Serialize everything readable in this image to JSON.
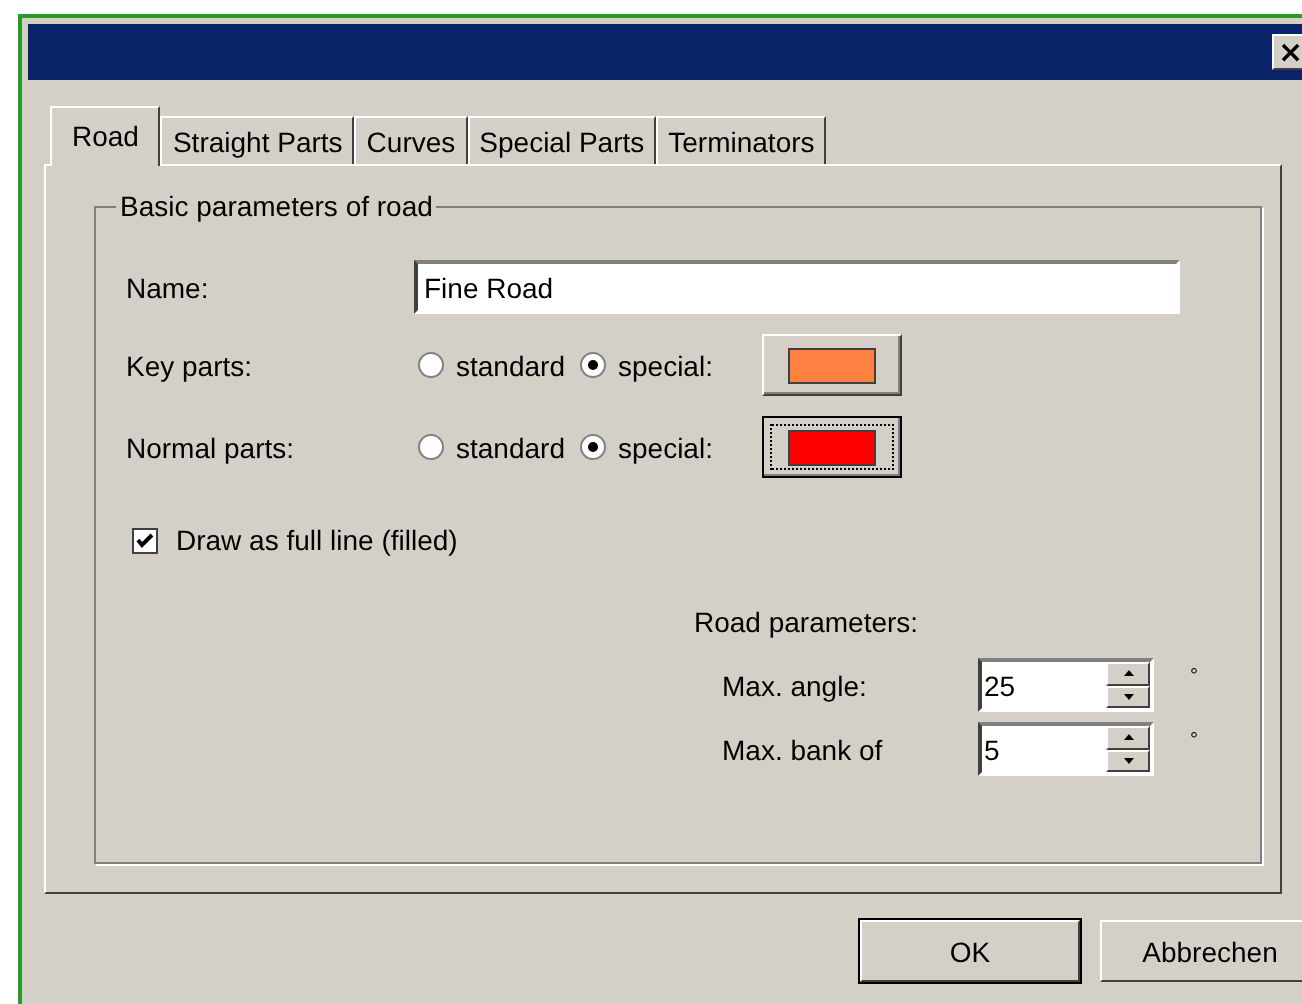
{
  "window": {
    "close": "×"
  },
  "tabs": [
    {
      "label": "Road",
      "selected": true
    },
    {
      "label": "Straight Parts",
      "selected": false
    },
    {
      "label": "Curves",
      "selected": false
    },
    {
      "label": "Special Parts",
      "selected": false
    },
    {
      "label": "Terminators",
      "selected": false
    }
  ],
  "group": {
    "title": "Basic parameters of road",
    "name": {
      "label": "Name:",
      "value": "Fine Road"
    },
    "part_rows": [
      {
        "label": "Key parts:",
        "options": [
          {
            "label": "standard",
            "selected": false
          },
          {
            "label": "special:",
            "selected": true
          }
        ],
        "color": "#ff8040",
        "focused": false
      },
      {
        "label": "Normal parts:",
        "options": [
          {
            "label": "standard",
            "selected": false
          },
          {
            "label": "special:",
            "selected": true
          }
        ],
        "color": "#ff0000",
        "focused": true
      }
    ],
    "full_line": {
      "label": "Draw as full line (filled)",
      "checked": true
    },
    "road_parameters": {
      "title": "Road parameters:",
      "rows": [
        {
          "label": "Max. angle:",
          "value": "25",
          "unit": "°"
        },
        {
          "label": "Max. bank of",
          "value": "5",
          "unit": "°"
        }
      ]
    }
  },
  "buttons": [
    {
      "label": "OK",
      "default": true
    },
    {
      "label": "Abbrechen",
      "default": false
    }
  ]
}
